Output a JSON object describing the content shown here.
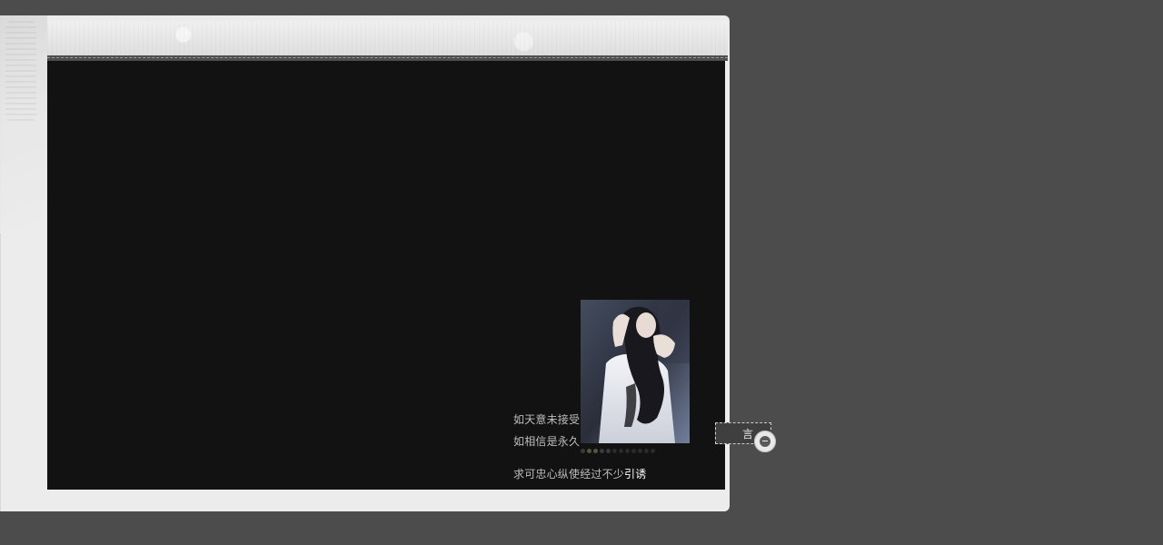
{
  "lyrics": {
    "line1": "如天意未接受",
    "line2": "如相信是永久",
    "line3_prefix": "求可忠心纵使经过不少",
    "line3_highlight": "引诱"
  },
  "message_tab": {
    "label": "言"
  },
  "icons": {
    "chat": "chat-bubble-icon"
  },
  "colors": {
    "page_background": "#4c4c4c",
    "frame": "#ececec",
    "content": "#121212",
    "lyric_text": "#bdbdbd",
    "highlight_text": "#ffffff"
  },
  "photo_indicator": {
    "total": 12,
    "active": 3
  }
}
